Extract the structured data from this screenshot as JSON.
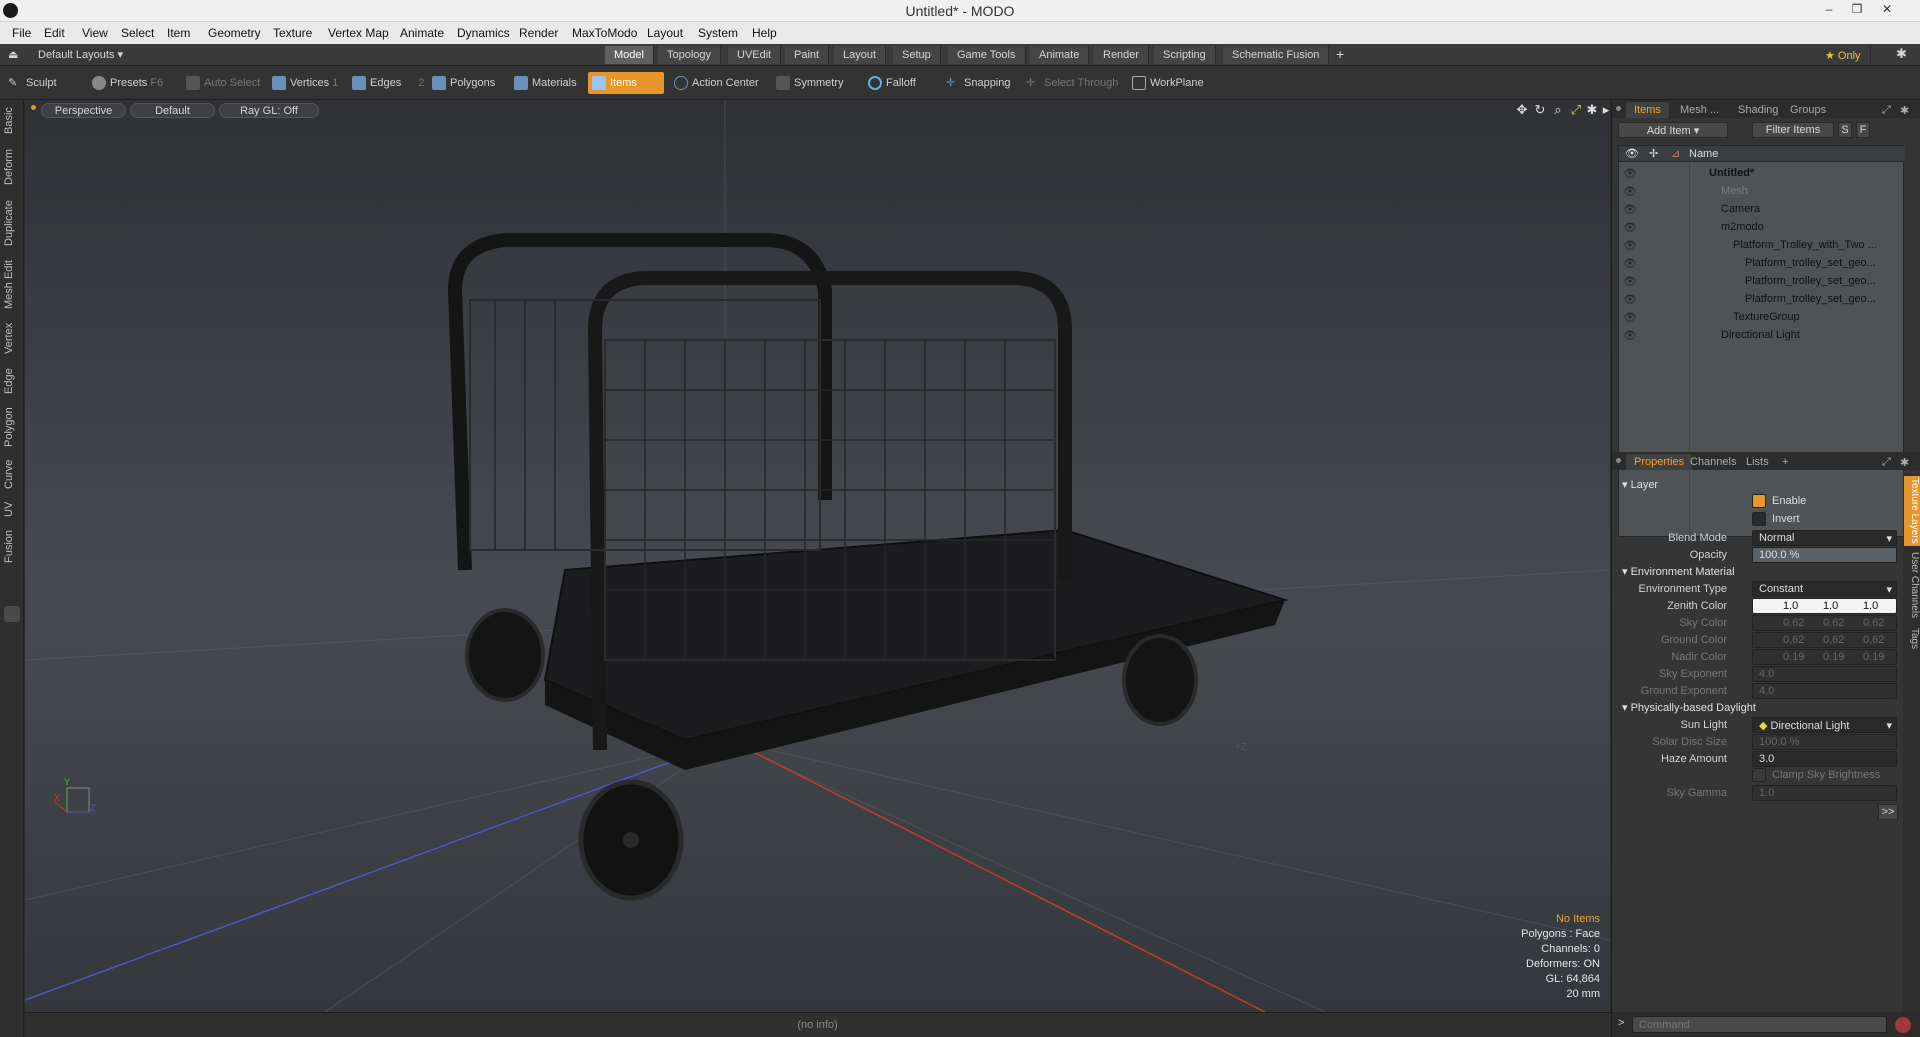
{
  "window": {
    "title": "Untitled* - MODO",
    "minimize": "–",
    "restore": "❐",
    "close": "✕"
  },
  "menu": [
    "File",
    "Edit",
    "View",
    "Select",
    "Item",
    "Geometry",
    "Texture",
    "Vertex Map",
    "Animate",
    "Dynamics",
    "Render",
    "MaxToModo",
    "Layout",
    "System",
    "Help"
  ],
  "layoutbar": {
    "layouts_label": "Default Layouts ▾",
    "tabs": [
      "Model",
      "Topology",
      "UVEdit",
      "Paint",
      "Layout",
      "Setup",
      "Game Tools",
      "Animate",
      "Render",
      "Scripting",
      "Schematic Fusion",
      "+"
    ],
    "active_tab": "Model",
    "only_label": "★ Only"
  },
  "toolbar": {
    "sculpt": "Sculpt",
    "presets": "Presets",
    "presets_key": "F6",
    "auto_select": "Auto Select",
    "vertices": "Vertices",
    "vertices_count": "1",
    "edges": "Edges",
    "edges_count": "2",
    "polygons": "Polygons",
    "materials": "Materials",
    "items": "Items",
    "action_center": "Action Center",
    "symmetry": "Symmetry",
    "falloff": "Falloff",
    "snapping": "Snapping",
    "select_through": "Select Through",
    "workplane": "WorkPlane"
  },
  "left_tabs": [
    "Basic",
    "Deform",
    "Duplicate",
    "Mesh Edit",
    "Vertex",
    "Edge",
    "Polygon",
    "Curve",
    "UV",
    "Fusion"
  ],
  "viewport": {
    "view": "Perspective",
    "shading": "Default",
    "raygl": "Ray GL: Off",
    "stats": {
      "selection": "No Items",
      "polygons": "Polygons : Face",
      "channels": "Channels: 0",
      "deformers": "Deformers: ON",
      "gl": "GL: 64,864",
      "scale": "20 mm"
    },
    "axis_labels": {
      "x": "X",
      "y": "Y",
      "z": "Z"
    }
  },
  "statusbar": "(no info)",
  "items_panel": {
    "tabs": [
      "Items",
      "Mesh ...",
      "Shading",
      "Groups"
    ],
    "add_item": "Add Item",
    "filter_items": "Filter Items",
    "s_btn": "S",
    "f_btn": "F",
    "column_name": "Name",
    "rows": [
      {
        "name": "Untitled*",
        "indent": 0,
        "bold": true,
        "dim": false
      },
      {
        "name": "Mesh",
        "indent": 1,
        "bold": false,
        "dim": true
      },
      {
        "name": "Camera",
        "indent": 1,
        "bold": false,
        "dim": false
      },
      {
        "name": "m2modo",
        "indent": 1,
        "bold": false,
        "dim": false
      },
      {
        "name": "Platform_Trolley_with_Two ...",
        "indent": 2,
        "bold": false,
        "dim": false
      },
      {
        "name": "Platform_trolley_set_geo...",
        "indent": 3,
        "bold": false,
        "dim": false
      },
      {
        "name": "Platform_trolley_set_geo...",
        "indent": 3,
        "bold": false,
        "dim": false
      },
      {
        "name": "Platform_trolley_set_geo...",
        "indent": 3,
        "bold": false,
        "dim": false
      },
      {
        "name": "TextureGroup",
        "indent": 2,
        "bold": false,
        "dim": false
      },
      {
        "name": "Directional Light",
        "indent": 1,
        "bold": false,
        "dim": false
      }
    ]
  },
  "properties_panel": {
    "tabs": [
      "Properties",
      "Channels",
      "Lists",
      "+"
    ],
    "side_tabs": [
      "Texture Layers",
      "User Channels",
      "Tags"
    ],
    "layer_header": "Layer",
    "enable": "Enable",
    "invert": "Invert",
    "blend_mode_label": "Blend Mode",
    "blend_mode": "Normal",
    "opacity_label": "Opacity",
    "opacity": "100.0 %",
    "env_header": "Environment Material",
    "env_type_label": "Environment Type",
    "env_type": "Constant",
    "zenith_label": "Zenith Color",
    "zenith": [
      "1.0",
      "1.0",
      "1.0"
    ],
    "sky_label": "Sky Color",
    "sky": [
      "0.62",
      "0.62",
      "0.62"
    ],
    "ground_label": "Ground Color",
    "ground": [
      "0.62",
      "0.62",
      "0.62"
    ],
    "nadir_label": "Nadir Color",
    "nadir": [
      "0.19",
      "0.19",
      "0.19"
    ],
    "sky_exp_label": "Sky Exponent",
    "sky_exp": "4.0",
    "ground_exp_label": "Ground Exponent",
    "ground_exp": "4.0",
    "daylight_header": "Physically-based Daylight",
    "sun_light_label": "Sun Light",
    "sun_light": "Directional Light",
    "solar_disc_label": "Solar Disc Size",
    "solar_disc": "100.0 %",
    "haze_label": "Haze Amount",
    "haze": "3.0",
    "clamp_label": "Clamp Sky Brightness",
    "sky_gamma_label": "Sky Gamma",
    "sky_gamma": "1.0",
    "more": ">>"
  },
  "command": {
    "placeholder": "Command",
    "prompt": ">"
  },
  "colors": {
    "accent": "#e8962a",
    "panel": "#353535",
    "viewport": "#474b50"
  }
}
